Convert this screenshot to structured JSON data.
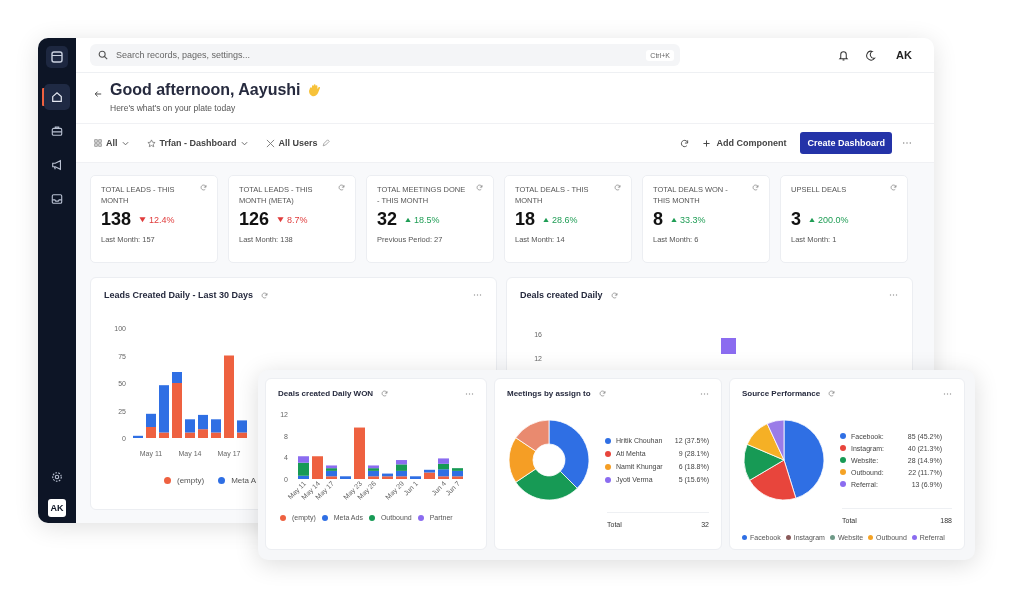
{
  "search": {
    "placeholder": "Search records, pages, settings...",
    "shortcut": "Ctrl+K"
  },
  "user": {
    "initials": "AK"
  },
  "sidebar": {
    "items": [
      {
        "selected": true
      },
      {
        "selected": false
      },
      {
        "selected": false
      },
      {
        "selected": false
      }
    ],
    "avatar": "AK"
  },
  "greeting": {
    "title": "Good afternoon, Aayushi",
    "subtitle": "Here's what's on your plate today"
  },
  "filters": [
    {
      "label": "All",
      "dropdown": true,
      "editable": false
    },
    {
      "label": "Trfan - Dashboard",
      "dropdown": true,
      "editable": false
    },
    {
      "label": "All Users",
      "dropdown": false,
      "editable": true
    }
  ],
  "actions": {
    "add": "Add Component",
    "create": "Create Dashboard"
  },
  "kpis": [
    {
      "title": "TOTAL LEADS - THIS MONTH",
      "value": "138",
      "change": "12.4%",
      "positive": false,
      "compare": "Last Month: 157"
    },
    {
      "title": "TOTAL LEADS - THIS MONTH (META)",
      "value": "126",
      "change": "8.7%",
      "positive": false,
      "compare": "Last Month: 138"
    },
    {
      "title": "TOTAL MEETINGS DONE - THIS MONTH",
      "value": "32",
      "change": "18.5%",
      "positive": true,
      "compare": "Previous Period: 27"
    },
    {
      "title": "TOTAL DEALS - THIS MONTH",
      "value": "18",
      "change": "28.6%",
      "positive": true,
      "compare": "Last Month: 14"
    },
    {
      "title": "TOTAL DEALS WON - THIS MONTH",
      "value": "8",
      "change": "33.3%",
      "positive": true,
      "compare": "Last Month: 6"
    },
    {
      "title": "UPSELL DEALS",
      "value": "3",
      "change": "200.0%",
      "positive": true,
      "compare": "Last Month: 1"
    }
  ],
  "leads_chart": {
    "title": "Leads Created Daily - Last 30 Days",
    "chart_data": {
      "type": "bar",
      "stacked": true,
      "legend": "bottom",
      "categories": [
        null,
        "May 11",
        null,
        null,
        "May 14",
        null,
        null,
        "May 17",
        null
      ],
      "ylim": [
        0,
        100
      ],
      "yticks": [
        0,
        25,
        50,
        75,
        100
      ],
      "series": [
        {
          "name": "(empty)",
          "color": "#ee6140",
          "values": [
            0,
            10,
            5,
            50,
            5,
            8,
            5,
            75,
            5
          ]
        },
        {
          "name": "Meta A",
          "color": "#2f6fe4",
          "values": [
            2,
            12,
            43,
            10,
            12,
            13,
            12,
            0,
            11
          ]
        }
      ]
    }
  },
  "deals_chart": {
    "title": "Deals created Daily",
    "axis_labels": [
      "16",
      "12"
    ]
  },
  "won_chart": {
    "title": "Deals created Daily WON",
    "chart_data": {
      "type": "bar",
      "stacked": true,
      "legend": "bottom",
      "categories": [
        "May 11",
        "May 14",
        "May 17",
        null,
        "May 23",
        "May 26",
        null,
        "May 29",
        "Jun 1",
        null,
        "Jun 4",
        "Jun 7"
      ],
      "ylim": [
        0,
        12
      ],
      "yticks": [
        0,
        4,
        8,
        12
      ],
      "series": [
        {
          "name": "(empty)",
          "color": "#ee6140",
          "values": [
            0,
            4.2,
            0.5,
            0,
            9.5,
            0.5,
            0.5,
            0.5,
            0,
            1.2,
            0.5,
            0.5
          ]
        },
        {
          "name": "Meta Ads",
          "color": "#2f6fe4",
          "values": [
            0.6,
            0,
            1,
            0.5,
            0,
            1,
            0.5,
            1,
            0.5,
            0.5,
            1.3,
            1
          ]
        },
        {
          "name": "Outbound",
          "color": "#179a55",
          "values": [
            2.4,
            0,
            0.5,
            0,
            0,
            0.5,
            0,
            1.2,
            0,
            0,
            1,
            0.5
          ]
        },
        {
          "name": "Partner",
          "color": "#8b6cf0",
          "values": [
            1.2,
            0,
            0.5,
            0,
            0,
            0.5,
            0,
            0.8,
            0,
            0,
            1,
            0
          ]
        }
      ]
    }
  },
  "meetings_chart": {
    "title": "Meetings by assign to",
    "chart_data": {
      "type": "donut",
      "categories": [
        "Hritik Chouhan",
        "Ati Mehta",
        "Namit Khungar",
        "Jyoti Verma"
      ],
      "series": [
        {
          "values": [
            37.5,
            28.1,
            18.8,
            15.6
          ]
        }
      ],
      "colors": [
        "#2f6fe4",
        "#179a55",
        "#f59e25",
        "#e98a6f"
      ]
    },
    "rows": [
      {
        "value": "12 (37.5%)",
        "color": "#2f6fe4"
      },
      {
        "value": "9 (28.1%)",
        "color": "#e8453c"
      },
      {
        "value": "6 (18.8%)",
        "color": "#f59e25"
      },
      {
        "value": "5 (15.6%)",
        "color": "#8b6cf0"
      }
    ],
    "total_label": "Total",
    "total": "32"
  },
  "source_chart": {
    "title": "Source Performance",
    "chart_data": {
      "type": "pie",
      "categories": [
        "Facebook",
        "Instagram",
        "Website",
        "Outbound",
        "Referral"
      ],
      "series": [
        {
          "values": [
            45.2,
            21.3,
            14.9,
            11.7,
            6.9
          ]
        }
      ],
      "colors": [
        "#2f6fe4",
        "#e8453c",
        "#179a55",
        "#f5b025",
        "#9a7ce8"
      ]
    },
    "rows": [
      {
        "label": "Facebook:",
        "value": "85 (45.2%)",
        "color": "#2f6fe4"
      },
      {
        "label": "Instagram:",
        "value": "40 (21.3%)",
        "color": "#e8453c"
      },
      {
        "label": "Website:",
        "value": "28 (14.9%)",
        "color": "#179a55"
      },
      {
        "label": "Outbound:",
        "value": "22 (11.7%)",
        "color": "#f5a325"
      },
      {
        "label": "Referral:",
        "value": "13 (6.9%)",
        "color": "#8b6cf0"
      }
    ],
    "total_label": "Total",
    "total": "188",
    "legend": [
      {
        "color": "#2f6fe4"
      },
      {
        "color": "#8a5a5a"
      },
      {
        "color": "#6f9a88"
      },
      {
        "color": "#f5a325"
      },
      {
        "color": "#8b6cf0"
      }
    ]
  }
}
